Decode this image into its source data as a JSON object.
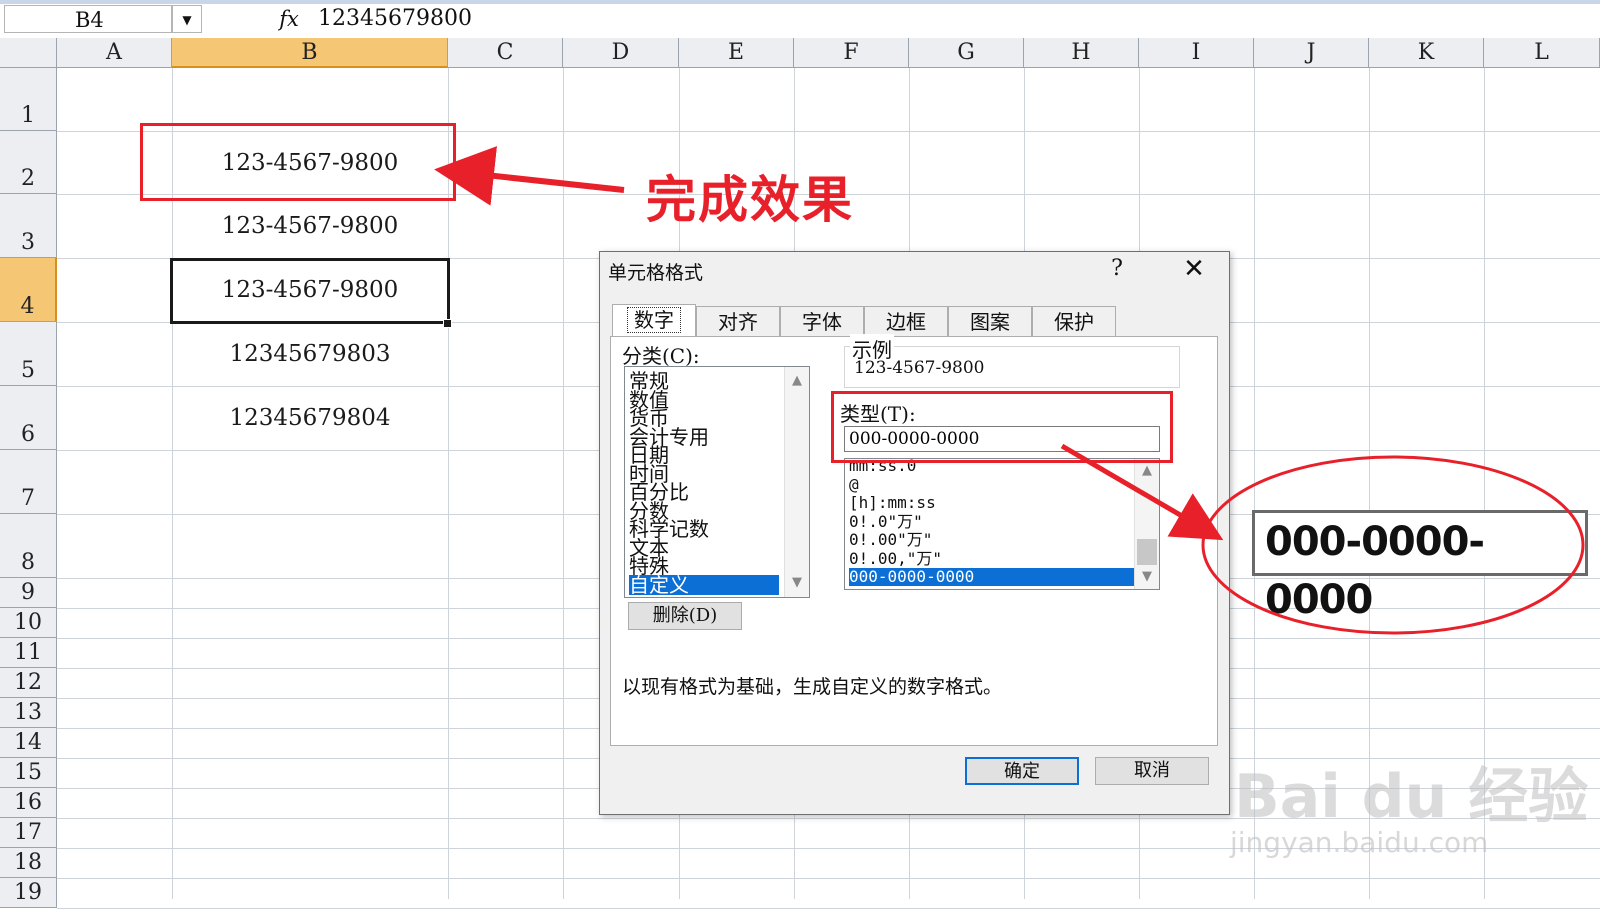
{
  "formula_bar": {
    "name_box": "B4",
    "fx_icon": "fx-icon",
    "value": "12345679800"
  },
  "columns": [
    "A",
    "B",
    "C",
    "D",
    "E",
    "F",
    "G",
    "H",
    "I",
    "J",
    "K",
    "L"
  ],
  "selected_column": "B",
  "rows": [
    "1",
    "2",
    "3",
    "4",
    "5",
    "6",
    "7",
    "8",
    "9",
    "10",
    "11",
    "12",
    "13",
    "14",
    "15",
    "16",
    "17",
    "18",
    "19"
  ],
  "selected_row": "4",
  "cells_b": [
    {
      "row": "2",
      "text": "123-4567-9800"
    },
    {
      "row": "3",
      "text": "123-4567-9800"
    },
    {
      "row": "4",
      "text": "123-4567-9800"
    },
    {
      "row": "5",
      "text": "12345679803"
    },
    {
      "row": "6",
      "text": "12345679804"
    }
  ],
  "annotation": {
    "label": "完成效果",
    "color": "#e8202a"
  },
  "dialog": {
    "title": "单元格格式",
    "help": "?",
    "close_icon": "close-icon",
    "tabs": [
      {
        "label": "数字",
        "active": true
      },
      {
        "label": "对齐",
        "active": false
      },
      {
        "label": "字体",
        "active": false
      },
      {
        "label": "边框",
        "active": false
      },
      {
        "label": "图案",
        "active": false
      },
      {
        "label": "保护",
        "active": false
      }
    ],
    "category_label": "分类(C):",
    "categories": [
      {
        "label": "常规",
        "selected": false
      },
      {
        "label": "数值",
        "selected": false
      },
      {
        "label": "货币",
        "selected": false
      },
      {
        "label": "会计专用",
        "selected": false
      },
      {
        "label": "日期",
        "selected": false
      },
      {
        "label": "时间",
        "selected": false
      },
      {
        "label": "百分比",
        "selected": false
      },
      {
        "label": "分数",
        "selected": false
      },
      {
        "label": "科学记数",
        "selected": false
      },
      {
        "label": "文本",
        "selected": false
      },
      {
        "label": "特殊",
        "selected": false
      },
      {
        "label": "自定义",
        "selected": true
      }
    ],
    "sample_label": "示例",
    "sample_value": "123-4567-9800",
    "type_label": "类型(T):",
    "type_value": "000-0000-0000",
    "type_list": [
      {
        "label": "mm:ss.0",
        "selected": false
      },
      {
        "label": "@",
        "selected": false
      },
      {
        "label": "[h]:mm:ss",
        "selected": false
      },
      {
        "label": "0!.0\"万\"",
        "selected": false
      },
      {
        "label": "0!.00\"万\"",
        "selected": false
      },
      {
        "label": "0!.00,\"万\"",
        "selected": false
      },
      {
        "label": "000-0000-0000",
        "selected": true
      }
    ],
    "delete_button": "删除(D)",
    "description": "以现有格式为基础，生成自定义的数字格式。",
    "ok_button": "确定",
    "cancel_button": "取消"
  },
  "zoom_callout": {
    "value": "000-0000-0000"
  },
  "watermark": {
    "logo": "Bai du 经验",
    "url": "jingyan.baidu.com"
  }
}
